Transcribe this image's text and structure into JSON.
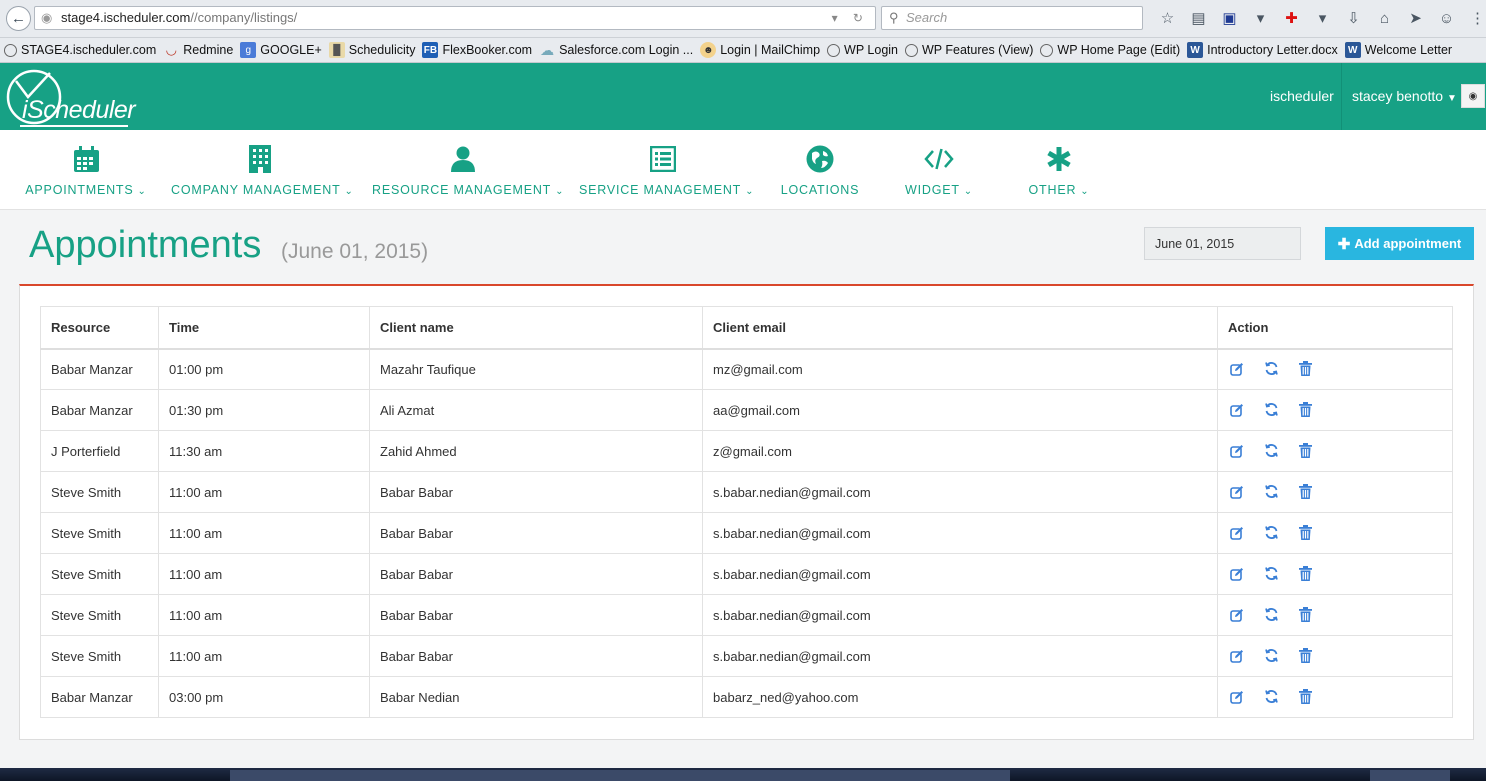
{
  "browser": {
    "url_host": "stage4.ischeduler.com",
    "url_path": "//company/listings/",
    "search_placeholder": "Search",
    "bookmarks": [
      {
        "label": "STAGE4.ischeduler.com",
        "icon": "clock-icon"
      },
      {
        "label": "Redmine",
        "icon": "redmine-icon"
      },
      {
        "label": "GOOGLE+",
        "icon": "google-plus-icon"
      },
      {
        "label": "Schedulicity",
        "icon": "schedulicity-icon"
      },
      {
        "label": "FlexBooker.com",
        "icon": "flexbooker-icon"
      },
      {
        "label": "Salesforce.com Login ...",
        "icon": "cloud-icon"
      },
      {
        "label": "Login | MailChimp",
        "icon": "mailchimp-icon"
      },
      {
        "label": "WP Login",
        "icon": "clock-icon"
      },
      {
        "label": "WP Features (View)",
        "icon": "clock-icon"
      },
      {
        "label": "WP Home Page (Edit)",
        "icon": "clock-icon"
      },
      {
        "label": "Introductory Letter.docx",
        "icon": "word-icon"
      },
      {
        "label": "Welcome Letter",
        "icon": "word-icon"
      }
    ]
  },
  "header": {
    "brand": "iScheduler",
    "company_link": "ischeduler",
    "user_name": "stacey benotto",
    "brand_color": "#17a185"
  },
  "nav": {
    "items": [
      {
        "label": "APPOINTMENTS",
        "icon": "calendar-icon",
        "dropdown": true
      },
      {
        "label": "COMPANY MANAGEMENT",
        "icon": "building-icon",
        "dropdown": true
      },
      {
        "label": "RESOURCE MANAGEMENT",
        "icon": "user-icon",
        "dropdown": true
      },
      {
        "label": "SERVICE MANAGEMENT",
        "icon": "list-icon",
        "dropdown": true
      },
      {
        "label": "LOCATIONS",
        "icon": "globe-icon",
        "dropdown": false
      },
      {
        "label": "WIDGET",
        "icon": "code-icon",
        "dropdown": true
      },
      {
        "label": "OTHER",
        "icon": "asterisk-icon",
        "dropdown": true
      }
    ]
  },
  "page": {
    "title": "Appointments",
    "subtitle": "(June 01, 2015)",
    "date_value": "June 01, 2015",
    "add_button": "Add appointment",
    "accent_color": "#d9472b",
    "button_color": "#29b6e0"
  },
  "table": {
    "columns": [
      "Resource",
      "Time",
      "Client name",
      "Client email",
      "Action"
    ],
    "rows": [
      {
        "resource": "Babar Manzar",
        "time": "01:00 pm",
        "client": "Mazahr Taufique",
        "email": "mz@gmail.com"
      },
      {
        "resource": "Babar Manzar",
        "time": "01:30 pm",
        "client": "Ali Azmat",
        "email": "aa@gmail.com"
      },
      {
        "resource": "J Porterfield",
        "time": "11:30 am",
        "client": "Zahid Ahmed",
        "email": "z@gmail.com"
      },
      {
        "resource": "Steve Smith",
        "time": "11:00 am",
        "client": "Babar Babar",
        "email": "s.babar.nedian@gmail.com"
      },
      {
        "resource": "Steve Smith",
        "time": "11:00 am",
        "client": "Babar Babar",
        "email": "s.babar.nedian@gmail.com"
      },
      {
        "resource": "Steve Smith",
        "time": "11:00 am",
        "client": "Babar Babar",
        "email": "s.babar.nedian@gmail.com"
      },
      {
        "resource": "Steve Smith",
        "time": "11:00 am",
        "client": "Babar Babar",
        "email": "s.babar.nedian@gmail.com"
      },
      {
        "resource": "Steve Smith",
        "time": "11:00 am",
        "client": "Babar Babar",
        "email": "s.babar.nedian@gmail.com"
      },
      {
        "resource": "Babar Manzar",
        "time": "03:00 pm",
        "client": "Babar Nedian",
        "email": "babarz_ned@yahoo.com"
      }
    ],
    "action_icons": [
      "edit-icon",
      "reschedule-icon",
      "delete-icon"
    ]
  }
}
